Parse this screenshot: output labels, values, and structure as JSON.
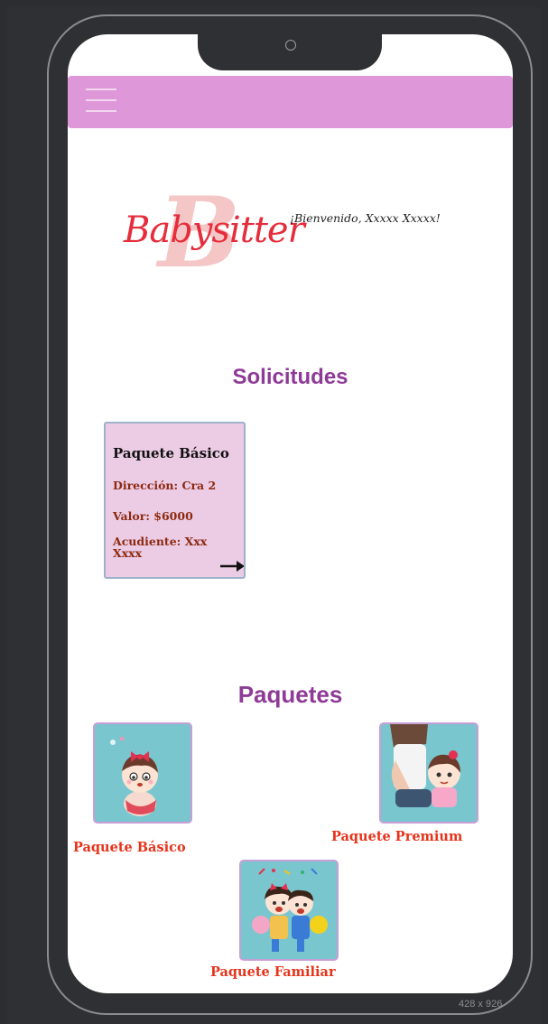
{
  "header": {
    "menu_icon": "hamburger-menu-icon",
    "brand_color": "#de97d8"
  },
  "brand": {
    "logo_text": "Babysitter",
    "logo_mark": "B"
  },
  "welcome_text": "¡Bienvenido, Xxxxx Xxxxx!",
  "solicitudes": {
    "title": "Solicitudes",
    "card": {
      "title": "Paquete Básico",
      "address": "Dirección: Cra 2",
      "value": "Valor: $6000",
      "guardian": "Acudiente: Xxx Xxxx",
      "arrow_icon": "arrow-right-icon"
    }
  },
  "paquetes": {
    "title": "Paquetes",
    "items": [
      {
        "label": "Paquete Básico",
        "icon": "baby-girl-illustration"
      },
      {
        "label": "Paquete Premium",
        "icon": "parent-and-child-illustration"
      },
      {
        "label": "Paquete Familiar",
        "icon": "kids-celebrating-illustration"
      }
    ]
  },
  "viewport_label": "428 x 926",
  "colors": {
    "accent_purple": "#8e3a97",
    "label_red": "#e6341b",
    "card_bg": "#eccbe5",
    "package_bg": "#79c6cf"
  }
}
